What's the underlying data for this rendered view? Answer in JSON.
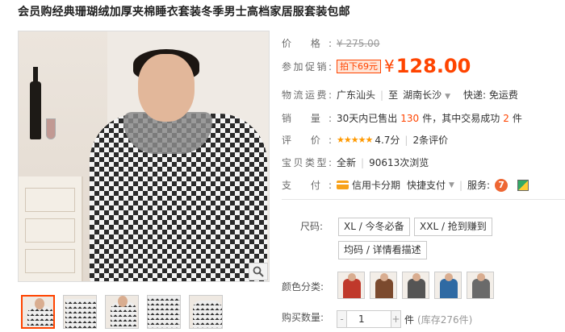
{
  "product": {
    "title": "会员购经典珊瑚绒加厚夹棉睡衣套装冬季男士高档家居服套装包邮"
  },
  "price": {
    "label": "价 格:",
    "original": "¥ 275.00"
  },
  "promo": {
    "label": "参加促销:",
    "tag": "拍下69元",
    "currency": "¥",
    "price": "128.00"
  },
  "shipping": {
    "label": "物流运费:",
    "from": "广东汕头",
    "to_prefix": "至",
    "to": "湖南长沙",
    "fee": "快递: 免运费"
  },
  "sales": {
    "label": "销 量:",
    "prefix": "30天内已售出",
    "count": "130",
    "middle": "件，其中交易成功",
    "success": "2",
    "suffix": "件"
  },
  "rating": {
    "label": "评 价:",
    "stars": "★★★★★",
    "score": "4.7分",
    "reviews": "2条评价"
  },
  "item_type": {
    "label": "宝贝类型:",
    "condition": "全新",
    "views": "90613次浏览"
  },
  "payment": {
    "label": "支 付:",
    "credit": "信用卡分期",
    "quick": "快捷支付",
    "service_label": "服务:",
    "service_icon_text": "7"
  },
  "size": {
    "label": "尺码:",
    "options": [
      "XL / 今冬必备",
      "XXL / 抢到赚到",
      "均码 / 详情看描述"
    ]
  },
  "color": {
    "label": "颜色分类:",
    "swatch_colors": [
      "#c0392b",
      "#7b4a2e",
      "#555555",
      "#2f6aa3",
      "#6a6a6a"
    ]
  },
  "quantity": {
    "label": "购买数量:",
    "minus": "-",
    "value": "1",
    "plus": "+",
    "unit": "件",
    "stock": "(库存276件)"
  },
  "icons": {
    "zoom": "magnifier-icon",
    "card": "credit-card-icon",
    "dropdown": "chevron-down-icon",
    "service7": "seven-day-return-icon",
    "service2": "guarantee-icon"
  },
  "colors": {
    "accent": "#ff4400",
    "star": "#ff9900"
  }
}
